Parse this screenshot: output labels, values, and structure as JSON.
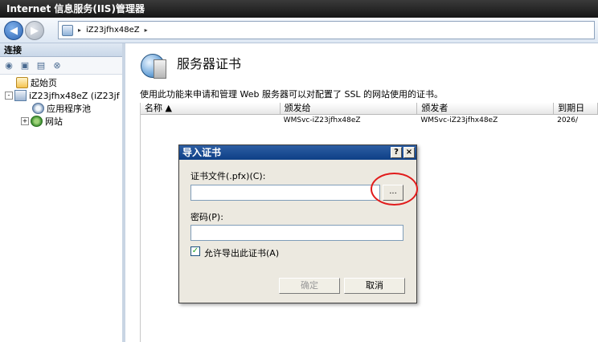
{
  "app": {
    "title": "Internet 信息服务(IIS)管理器"
  },
  "address": {
    "arrow_left": "▸",
    "server": "iZ23jfhx48eZ",
    "arrow_right": "▸"
  },
  "connections": {
    "header": "连接",
    "tree": [
      {
        "label": "起始页"
      },
      {
        "label": "iZ23jfhx48eZ (iZ23jf",
        "expander": "-"
      },
      {
        "label": "应用程序池"
      },
      {
        "label": "网站",
        "expander": "+"
      }
    ]
  },
  "main": {
    "title": "服务器证书",
    "description": "使用此功能来申请和管理 Web 服务器可以对配置了 SSL 的网站使用的证书。",
    "columns": [
      "名称 ▲",
      "颁发给",
      "颁发者",
      "到期日"
    ],
    "rows": [
      {
        "name": "",
        "issued_to": "WMSvc-iZ23jfhx48eZ",
        "issued_by": "WMSvc-iZ23jfhx48eZ",
        "expires": "2026/"
      }
    ]
  },
  "dialog": {
    "title": "导入证书",
    "help_label": "?",
    "close_label": "×",
    "file_label": "证书文件(.pfx)(C):",
    "file_value": "",
    "browse_label": "...",
    "password_label": "密码(P):",
    "password_value": "",
    "allow_export_label": "允许导出此证书(A)",
    "allow_export_checked": true,
    "checkmark": "✓",
    "ok_label": "确定",
    "cancel_label": "取消"
  },
  "icons": {
    "back": "arrow-left",
    "forward": "arrow-right",
    "globe": "globe-certificate",
    "highlight_color": "#e11b1b"
  }
}
